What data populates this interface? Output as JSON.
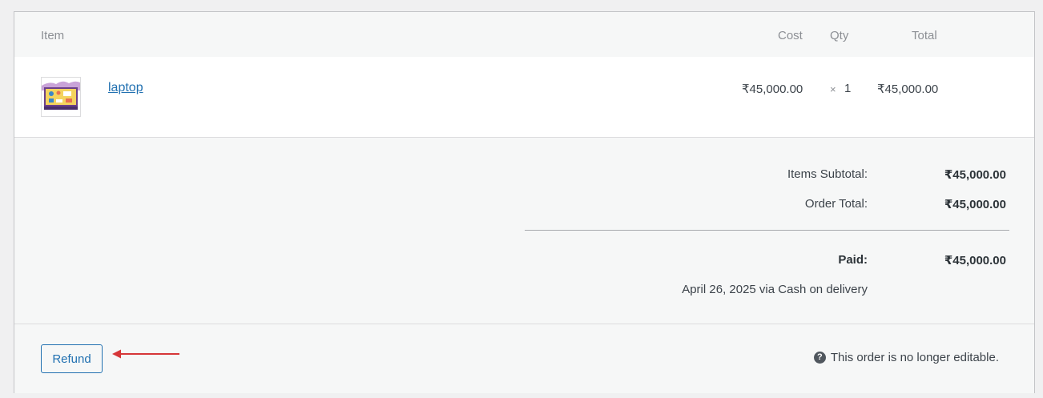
{
  "table": {
    "headers": {
      "item": "Item",
      "cost": "Cost",
      "qty": "Qty",
      "total": "Total"
    },
    "rows": [
      {
        "name": "laptop",
        "cost": "₹45,000.00",
        "qty_prefix": "×",
        "qty": "1",
        "total": "₹45,000.00",
        "thumbnail_icon": "product-thumbnail-icon"
      }
    ]
  },
  "totals": {
    "items_subtotal_label": "Items Subtotal:",
    "items_subtotal_value": "₹45,000.00",
    "order_total_label": "Order Total:",
    "order_total_value": "₹45,000.00",
    "paid_label": "Paid:",
    "paid_value": "₹45,000.00",
    "payment_note": "April 26, 2025 via Cash on delivery"
  },
  "footer": {
    "refund_label": "Refund",
    "note_icon": "help-icon",
    "note_icon_glyph": "?",
    "not_editable_note": "This order is no longer editable."
  },
  "colors": {
    "link": "#2271b1",
    "annotation_arrow": "#d63638"
  }
}
